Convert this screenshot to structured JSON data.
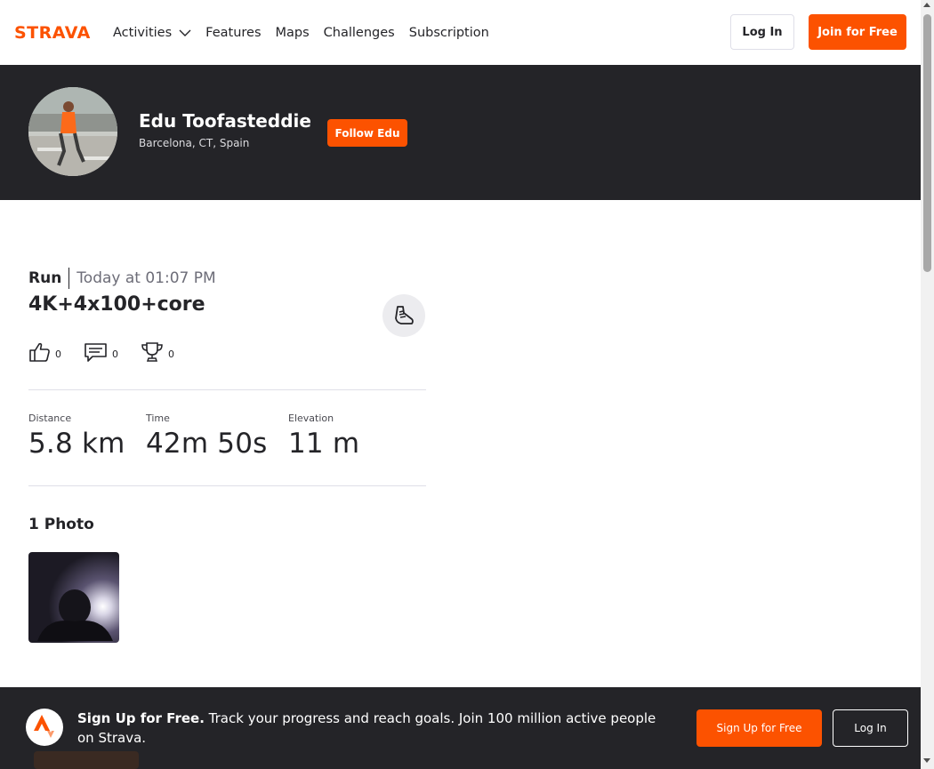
{
  "nav": {
    "logo_text": "STRAVA",
    "links": [
      "Activities",
      "Features",
      "Maps",
      "Challenges",
      "Subscription"
    ],
    "login_label": "Log In",
    "join_label": "Join for Free"
  },
  "athlete": {
    "name": "Edu Toofasteddie",
    "location": "Barcelona, CT, Spain",
    "follow_label": "Follow Edu"
  },
  "activity": {
    "type": "Run",
    "time": "Today at 01:07 PM",
    "title": "4K+4x100+core",
    "kudos": "0",
    "comments": "0",
    "achievements": "0",
    "stats": [
      {
        "label": "Distance",
        "value": "5.8 km"
      },
      {
        "label": "Time",
        "value": "42m 50s"
      },
      {
        "label": "Elevation",
        "value": "11 m"
      }
    ],
    "photos_title": "1 Photo"
  },
  "banner": {
    "lead": "Sign Up for Free.",
    "text": " Track your progress and reach goals. Join 100 million active people on Strava.",
    "signup_label": "Sign Up for Free",
    "login_label": "Log In"
  },
  "colors": {
    "brand": "#fc5200",
    "dark": "#242428"
  }
}
